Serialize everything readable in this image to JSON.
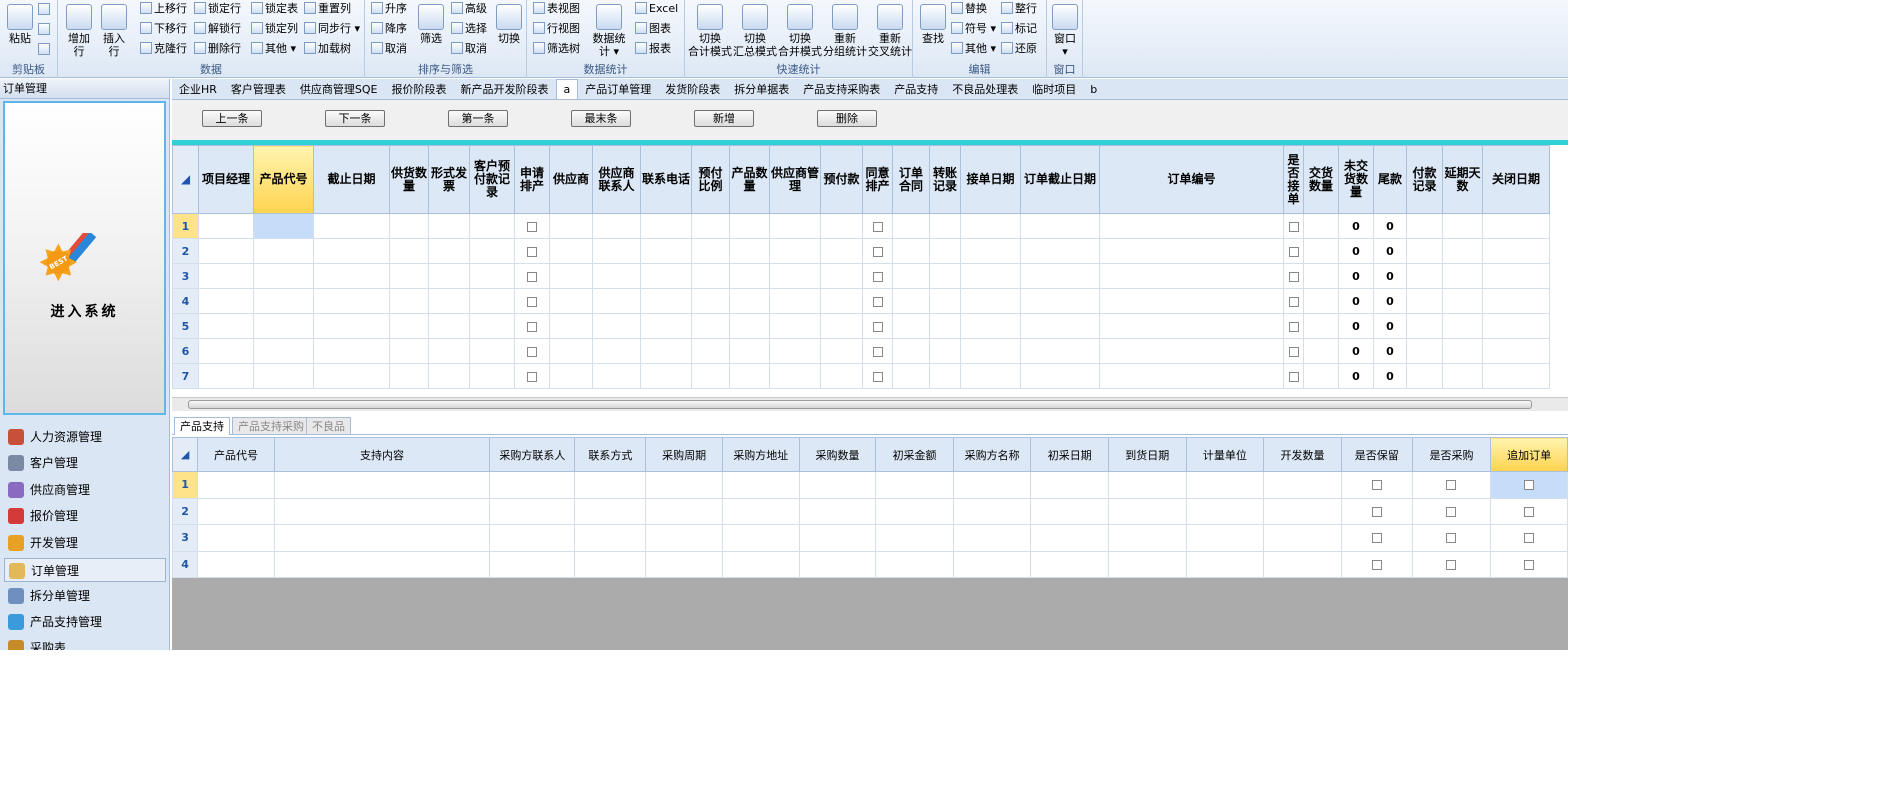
{
  "ribbon": {
    "clipboard": {
      "label": "剪贴板",
      "paste": "粘贴"
    },
    "data": {
      "label": "数据",
      "add_row": "增加行",
      "insert_row": "插入行",
      "move_up": "上移行",
      "move_down": "下移行",
      "clone_row": "克隆行",
      "lock_row": "锁定行",
      "unlock_row": "解锁行",
      "delete_row": "删除行",
      "lock_table": "锁定表",
      "lock_col": "锁定列",
      "other": "其他",
      "reset_col": "重置列",
      "sync_row": "同步行",
      "load_tree": "加载树"
    },
    "sort": {
      "label": "排序与筛选",
      "asc": "升序",
      "desc": "降序",
      "cancel": "取消",
      "filter": "筛选",
      "advanced": "高级",
      "select": "选择",
      "cancel2": "取消",
      "switch": "切换"
    },
    "stats": {
      "label": "数据统计",
      "data_stats": "数据统计",
      "table_view": "表视图",
      "row_view": "行视图",
      "filter_tree": "筛选树",
      "excel": "Excel",
      "chart": "图表",
      "report": "报表"
    },
    "quick": {
      "label": "快速统计",
      "b1": "切换\n合计模式",
      "b2": "切换\n汇总模式",
      "b3": "切换\n合并模式",
      "b4": "重新\n分组统计",
      "b5": "重新\n交叉统计"
    },
    "edit": {
      "label": "编辑",
      "find": "查找",
      "replace": "替换",
      "symbol": "符号",
      "other": "其他",
      "tidy": "整行",
      "mark": "标记",
      "restore": "还原"
    },
    "window": {
      "label": "窗口",
      "window": "窗口"
    }
  },
  "sidebar": {
    "title": "订单管理",
    "splash_text": "进入系统",
    "badge_text": "BEST",
    "items": [
      "人力资源管理",
      "客户管理",
      "供应商管理",
      "报价管理",
      "开发管理",
      "订单管理",
      "拆分单管理",
      "产品支持管理",
      "采购表"
    ]
  },
  "tabs": [
    "企业HR",
    "客户管理表",
    "供应商管理SQE",
    "报价阶段表",
    "新产品开发阶段表",
    "a",
    "产品订单管理",
    "发货阶段表",
    "拆分单据表",
    "产品支持采购表",
    "产品支持",
    "不良品处理表",
    "临时项目",
    "b"
  ],
  "buttons": [
    "上一条",
    "下一条",
    "第一条",
    "最末条",
    "新增",
    "删除"
  ],
  "grid": {
    "columns": [
      "项目经理",
      "产品代号",
      "截止日期",
      "供货数量",
      "形式发票",
      "客户预付款记录",
      "申请排产",
      "供应商",
      "供应商联系人",
      "联系电话",
      "预付比例",
      "产品数量",
      "供应商管理",
      "预付款",
      "同意排产",
      "订单合同",
      "转账记录",
      "接单日期",
      "订单截止日期",
      "订单编号",
      "是否接单",
      "交货数量",
      "未交货数量",
      "尾款",
      "付款记录",
      "延期天数",
      "关闭日期"
    ],
    "rows": [
      "1",
      "2",
      "3",
      "4",
      "5",
      "6",
      "7"
    ],
    "zero": "0"
  },
  "bottom_tabs": [
    "产品支持",
    "产品支持采购",
    "不良品"
  ],
  "grid2": {
    "columns": [
      "产品代号",
      "支持内容",
      "采购方联系人",
      "联系方式",
      "采购周期",
      "采购方地址",
      "采购数量",
      "初采金额",
      "采购方名称",
      "初采日期",
      "到货日期",
      "计量单位",
      "开发数量",
      "是否保留",
      "是否采购",
      "追加订单"
    ],
    "rows": [
      "1",
      "2",
      "3",
      "4"
    ]
  }
}
